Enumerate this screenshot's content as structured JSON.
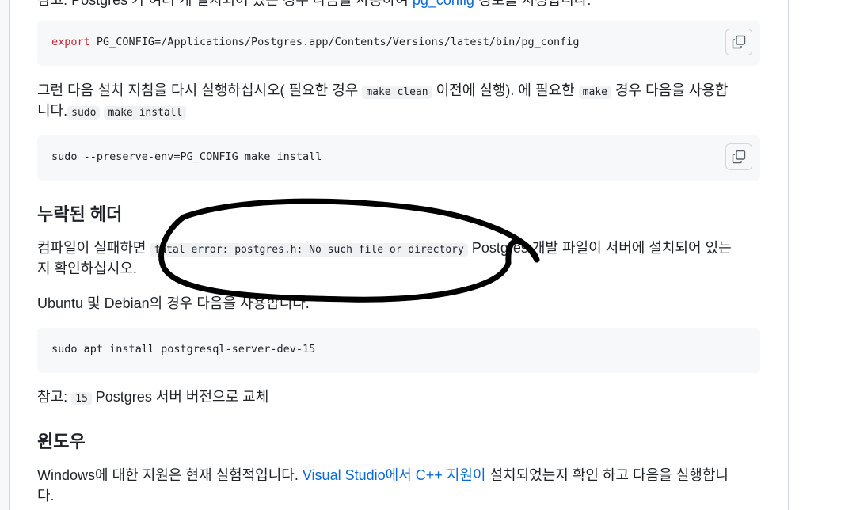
{
  "section_top": {
    "partial_line_a": "참고: Postgres 가 여러 개 설치되어 있는 경우 다음을 사용하여 ",
    "partial_link": "pg_config",
    "partial_line_b": " 경로를 지정합니다:"
  },
  "code1": {
    "keyword": "export",
    "rest": " PG_CONFIG=/Applications/Postgres.app/Contents/Versions/latest/bin/pg_config"
  },
  "para2": {
    "t1": "그런 다음 설치 지침을 다시 실행하십시오( 필요한 경우 ",
    "c1": "make clean",
    "t2": " 이전에 실행). 에 필요한 ",
    "c2": "make",
    "t3": " 경우 다음을 사용합",
    "t4": "니다.",
    "c3": "sudo",
    "c4": "make install"
  },
  "code2": {
    "text": "sudo --preserve-env=PG_CONFIG make install"
  },
  "heading1": "누락된 헤더",
  "para3": {
    "t1": "컴파일이 실패하면 ",
    "c1": "fatal error: postgres.h: No such file or directory",
    "t2": " Postgres 개발 파일이 서버에 설치되어 있는",
    "t3": "지 확인하십시오."
  },
  "para4": "Ubuntu 및 Debian의 경우 다음을 사용합니다.",
  "code3": {
    "text": "sudo apt install postgresql-server-dev-15"
  },
  "para5": {
    "t1": "참고: ",
    "c1": "15",
    "t2": " Postgres 서버 버전으로 교체"
  },
  "heading2": "윈도우",
  "para6": {
    "t1": "Windows에 대한 지원은 현재 실험적입니다. ",
    "link": "Visual Studio에서 C++ 지원이",
    "t2": " 설치되었는지 확인 하고 다음을 실행합니",
    "t3": "다."
  },
  "icons": {
    "copy": "copy-icon"
  }
}
